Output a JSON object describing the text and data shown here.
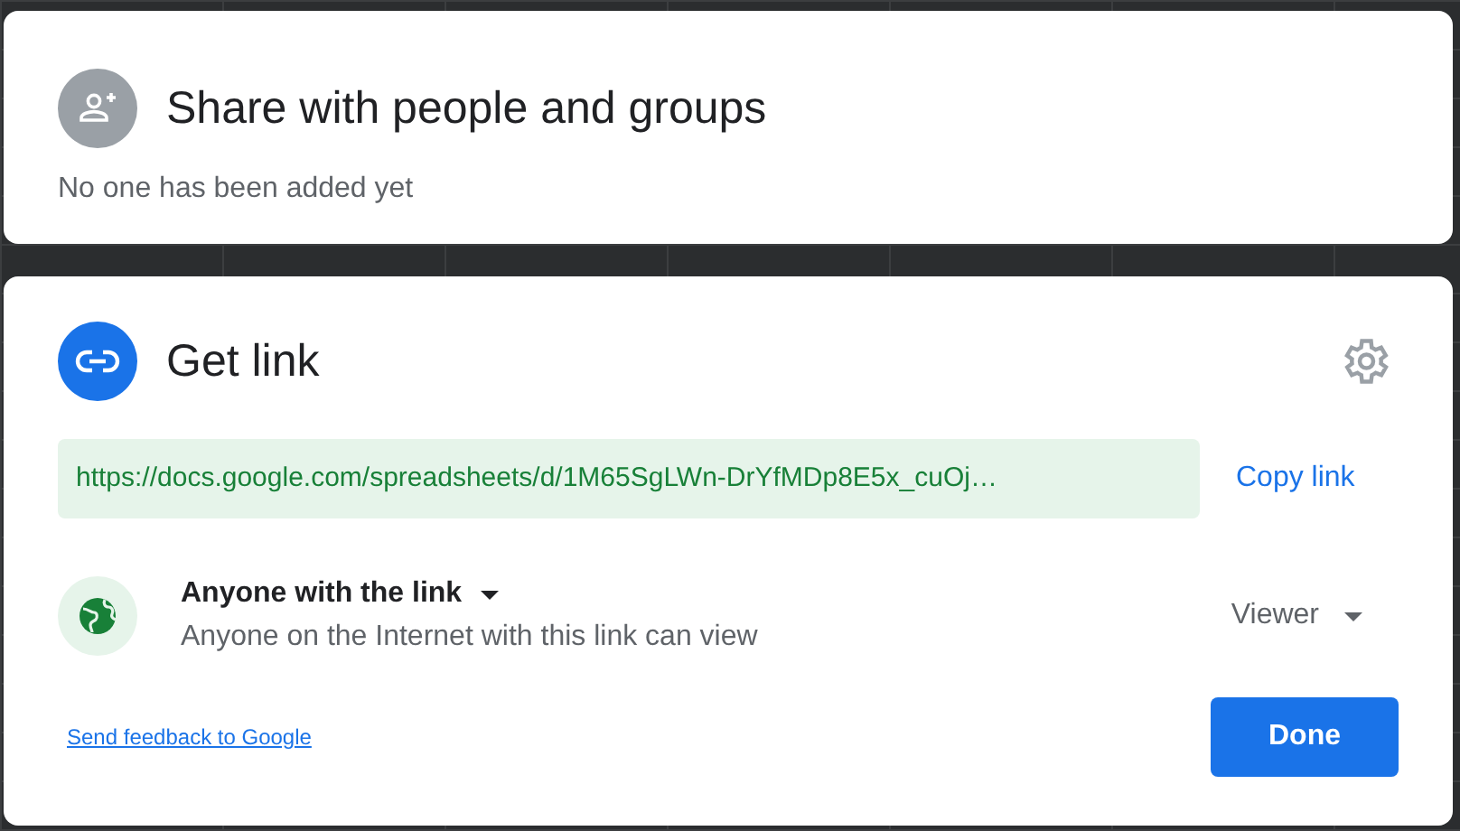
{
  "share_card": {
    "title": "Share with people and groups",
    "subtitle": "No one has been added yet"
  },
  "link_card": {
    "title": "Get link",
    "link": "https://docs.google.com/spreadsheets/d/1M65SgLWn-DrYfMDp8E5x_cuOj…",
    "copy_button": "Copy link",
    "access": {
      "label": "Anyone with the link",
      "description": "Anyone on the Internet with this link can view",
      "role": "Viewer"
    },
    "feedback_link": "Send feedback to Google",
    "done_button": "Done"
  }
}
